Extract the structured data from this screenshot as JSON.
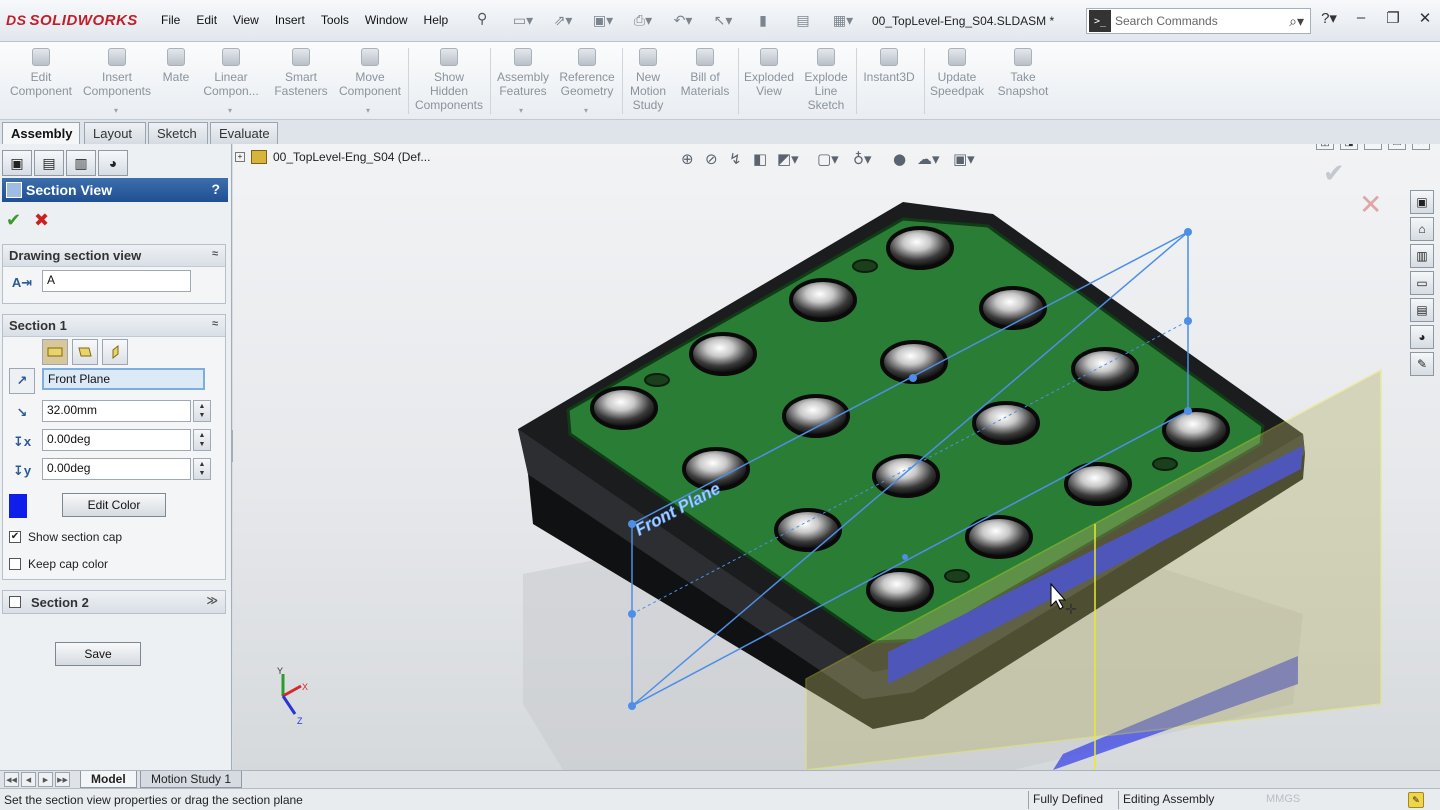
{
  "app": {
    "logo_prefix": "DS",
    "logo_text": "SOLIDWORKS",
    "document_title": "00_TopLevel-Eng_S04.SLDASM *"
  },
  "menu": [
    "File",
    "Edit",
    "View",
    "Insert",
    "Tools",
    "Window",
    "Help"
  ],
  "search": {
    "placeholder": "Search Commands",
    "prompt_glyph": ">_"
  },
  "ribbon": [
    {
      "label": "Edit\nComponent",
      "icon": "edit-component-icon"
    },
    {
      "label": "Insert\nComponents",
      "icon": "insert-components-icon"
    },
    {
      "label": "Mate",
      "icon": "mate-icon"
    },
    {
      "label": "Linear\nCompon...",
      "icon": "linear-pattern-icon"
    },
    {
      "label": "Smart\nFasteners",
      "icon": "smart-fasteners-icon"
    },
    {
      "label": "Move\nComponent",
      "icon": "move-component-icon"
    },
    {
      "label": "Show\nHidden\nComponents",
      "icon": "show-hidden-icon"
    },
    {
      "label": "Assembly\nFeatures",
      "icon": "assembly-features-icon"
    },
    {
      "label": "Reference\nGeometry",
      "icon": "reference-geometry-icon"
    },
    {
      "label": "New\nMotion\nStudy",
      "icon": "motion-study-icon"
    },
    {
      "label": "Bill of\nMaterials",
      "icon": "bom-icon"
    },
    {
      "label": "Exploded\nView",
      "icon": "exploded-view-icon"
    },
    {
      "label": "Explode\nLine\nSketch",
      "icon": "explode-line-icon"
    },
    {
      "label": "Instant3D",
      "icon": "instant3d-icon"
    },
    {
      "label": "Update\nSpeedpak",
      "icon": "speedpak-icon"
    },
    {
      "label": "Take\nSnapshot",
      "icon": "snapshot-icon"
    }
  ],
  "cm_tabs": [
    "Assembly",
    "Layout",
    "Sketch",
    "Evaluate"
  ],
  "property_manager": {
    "title": "Section View",
    "help": "?",
    "drawing_section": {
      "header": "Drawing section view",
      "name_value": "A"
    },
    "section1": {
      "header": "Section 1",
      "reference": "Front Plane",
      "offset": "32.00mm",
      "rot_x": "0.00deg",
      "rot_y": "0.00deg",
      "edit_color": "Edit Color",
      "cap_color": "#0f1ee8",
      "show_cap": "Show section cap",
      "show_cap_checked": true,
      "keep_cap": "Keep cap color",
      "keep_cap_checked": false
    },
    "section2": {
      "header": "Section 2",
      "checked": false
    },
    "save_label": "Save"
  },
  "graphics": {
    "tree_root": "00_TopLevel-Eng_S04  (Def...",
    "plane_label": "Front Plane",
    "triad": {
      "x": "X",
      "y": "Y",
      "z": "Z"
    }
  },
  "bottom_tabs": [
    "Model",
    "Motion Study 1"
  ],
  "status": {
    "message": "Set the section view properties or drag the section plane",
    "state": "Fully Defined",
    "mode": "Editing Assembly",
    "units": "MMGS"
  }
}
